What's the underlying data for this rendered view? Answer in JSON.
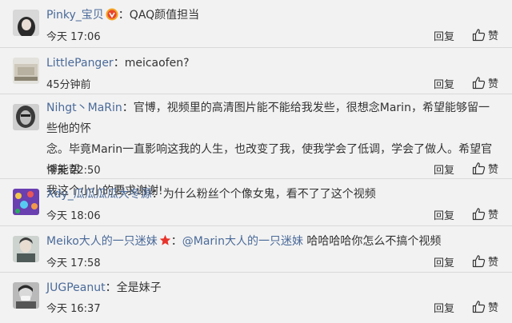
{
  "comments": [
    {
      "user": "Pinky_宝贝",
      "text": "QAQ颜值担当",
      "time": "今天 17:06",
      "reply": "回复",
      "like": "赞"
    },
    {
      "user": "LittlePanger",
      "text": "meicaofen?",
      "time": "45分钟前",
      "reply": "回复",
      "like": "赞"
    },
    {
      "user": "Nihgt丶MaRin",
      "line1": "官博，视频里的高清图片能不能给我发些，很想念Marin，希望能够留一些他的怀",
      "line2": "念。毕竟Marin一直影响这我的人生，也改变了我，使我学会了低调，学会了做人。希望官博能帮",
      "line3": "我这个小小的要求谢谢!",
      "time": "今天 22:50",
      "reply": "回复",
      "like": "赞"
    },
    {
      "user": "Xdy_瓜瓜瓜瓜大冬源",
      "text": "为什么粉丝个个像女鬼，看不了了这个视频",
      "time": "今天 18:06",
      "reply": "回复",
      "like": "赞"
    },
    {
      "user": "Meiko大人的一只迷妹",
      "mention": "@Marin大人的一只迷妹",
      "text": "哈哈哈哈你怎么不搞个视频",
      "time": "今天 17:58",
      "reply": "回复",
      "like": "赞"
    },
    {
      "user": "JUGPeanut",
      "text": "全是妹子",
      "time": "今天 16:37",
      "reply": "回复",
      "like": "赞"
    }
  ],
  "colors": {
    "username": "#4a6a99",
    "text": "#333333",
    "background": "#f2f2f2",
    "divider": "#d9d9d9"
  },
  "icons": {
    "like": "thumbs-up-icon",
    "vip": "vip-badge-icon",
    "star": "star-badge-icon"
  }
}
